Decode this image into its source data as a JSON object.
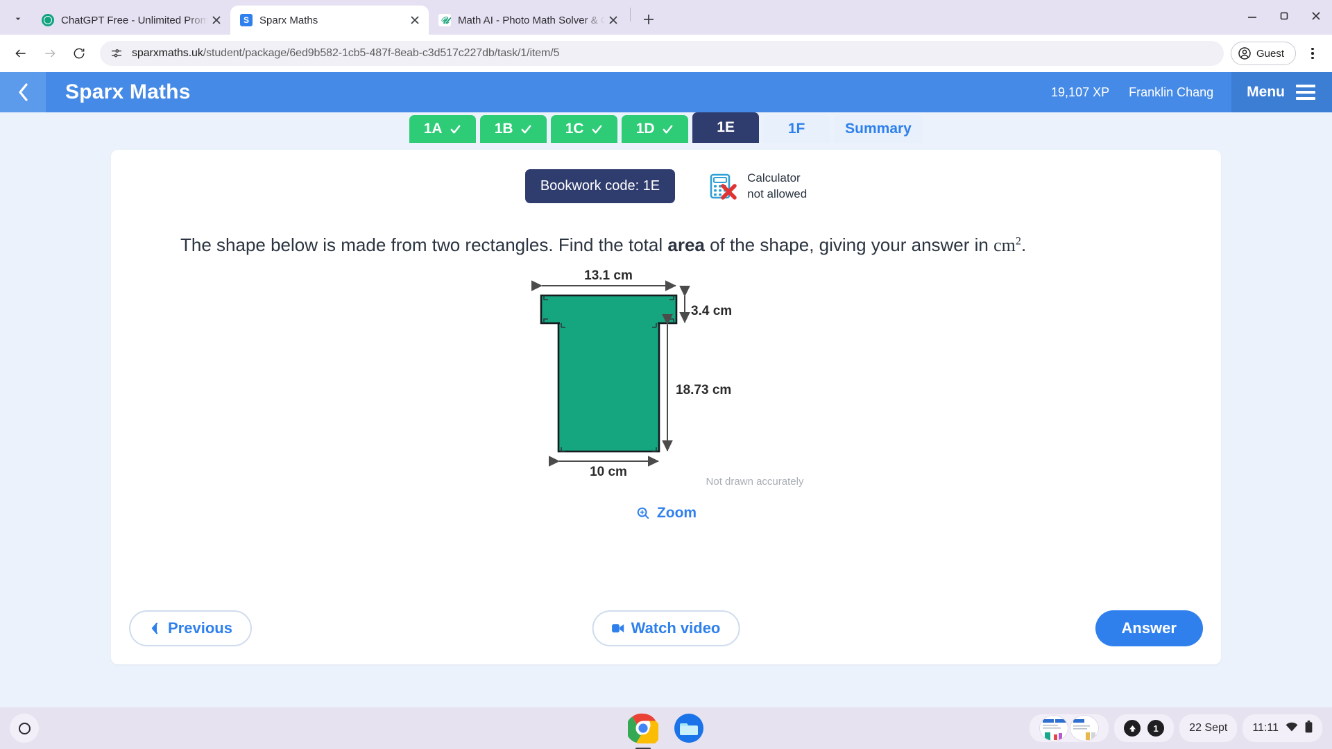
{
  "browser": {
    "tabs": [
      {
        "title": "ChatGPT Free - Unlimited Prom",
        "favicon": "chatgpt-icon",
        "active": false
      },
      {
        "title": "Sparx Maths",
        "favicon": "sparx-icon",
        "active": true
      },
      {
        "title": "Math AI - Photo Math Solver & C",
        "favicon": "mathai-icon",
        "active": false
      }
    ],
    "new_tab_label": "+",
    "window_controls": [
      "minimize",
      "maximize",
      "close"
    ],
    "toolbar": {
      "back": "back-arrow",
      "forward": "forward-arrow",
      "reload": "reload",
      "url_host": "sparxmaths.uk",
      "url_path": "/student/package/6ed9b582-1cb5-487f-8eab-c3d517c227db/task/1/item/5",
      "url_full": "sparxmaths.uk/student/package/6ed9b582-1cb5-487f-8eab-c3d517c227db/task/1/item/5",
      "profile_label": "Guest"
    }
  },
  "app": {
    "brand": "Sparx Maths",
    "xp": "19,107 XP",
    "user": "Franklin Chang",
    "menu_label": "Menu",
    "colors": {
      "appbar": "#458ae6",
      "appbar_back": "#5c9aec",
      "menu_block": "#3b7ed4",
      "accent_blue": "#2f80ed",
      "navy": "#2f3c6e",
      "green_done": "#2ecc77",
      "shape_fill": "#16a67f"
    }
  },
  "task_tabs": [
    {
      "label": "1A",
      "state": "done"
    },
    {
      "label": "1B",
      "state": "done"
    },
    {
      "label": "1C",
      "state": "done"
    },
    {
      "label": "1D",
      "state": "done"
    },
    {
      "label": "1E",
      "state": "current"
    },
    {
      "label": "1F",
      "state": "todo"
    },
    {
      "label": "Summary",
      "state": "todo"
    }
  ],
  "question_card": {
    "bookwork_code": "Bookwork code: 1E",
    "calculator_line1": "Calculator",
    "calculator_line2": "not allowed",
    "question_part1": "The shape below is made from two rectangles. Find the total ",
    "question_bold": "area",
    "question_part2": " of the shape, giving your answer in ",
    "question_unit": "cm",
    "question_unit_sup": "2",
    "question_end": ".",
    "not_drawn": "Not drawn accurately",
    "zoom_label": "Zoom"
  },
  "figure": {
    "top_width_label": "13.1 cm",
    "top_height_label": "3.4 cm",
    "side_height_label": "18.73 cm",
    "bottom_width_label": "10 cm"
  },
  "actions": {
    "previous": "Previous",
    "watch_video": "Watch video",
    "answer": "Answer"
  },
  "shelf": {
    "launcher": "launcher-icon",
    "apps": [
      "chrome-icon",
      "files-icon"
    ],
    "notification_count": "1",
    "date": "22 Sept",
    "time": "11:11"
  }
}
